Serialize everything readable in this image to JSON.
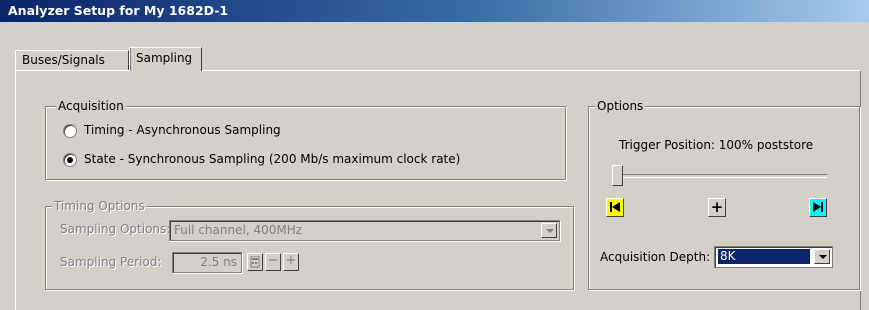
{
  "window": {
    "title": "Analyzer Setup for My 1682D-1"
  },
  "tabs": [
    {
      "label": "Buses/Signals"
    },
    {
      "label": "Sampling",
      "active": true
    }
  ],
  "acquisition": {
    "legend": "Acquisition",
    "options": [
      {
        "label": "Timing - Asynchronous Sampling",
        "selected": false
      },
      {
        "label": "State - Synchronous Sampling (200 Mb/s maximum clock rate)",
        "selected": true
      }
    ]
  },
  "timing_options": {
    "legend": "Timing Options",
    "sampling_options_label": "Sampling Options:",
    "sampling_options_value": "Full channel, 400MHz",
    "sampling_period_label": "Sampling Period:",
    "sampling_period_value": "2.5 ns",
    "minus": "−",
    "plus": "+"
  },
  "options": {
    "legend": "Options",
    "trigger_position_text": "Trigger Position: 100% poststore",
    "trigger_position_percent": 0,
    "acquisition_depth_label": "Acquisition Depth:",
    "acquisition_depth_value": "8K",
    "center_button": "+"
  },
  "colors": {
    "title_start": "#0a246a",
    "title_end": "#a6caf0",
    "accent_yellow": "#ffff00",
    "accent_cyan": "#00ffff"
  }
}
